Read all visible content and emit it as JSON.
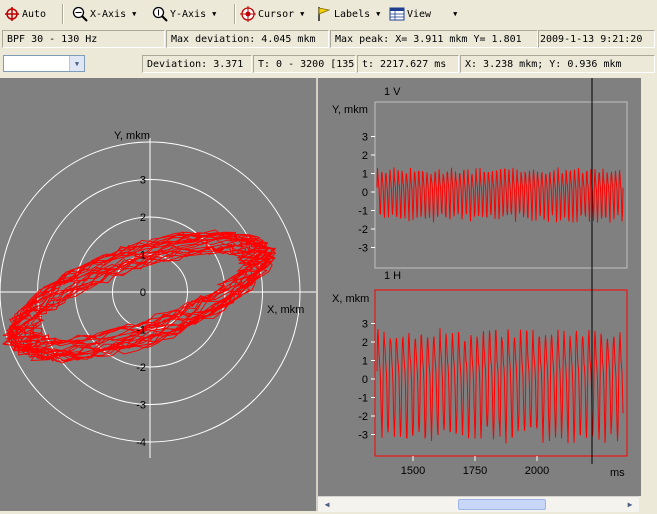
{
  "toolbar": {
    "auto": "Auto",
    "x_axis": "X-Axis",
    "y_axis": "Y-Axis",
    "cursor": "Cursor",
    "labels": "Labels",
    "view": "View"
  },
  "status1": {
    "filter": "BPF 30 - 130 Hz",
    "max_deviation": "Max deviation:  4.045 mkm",
    "max_peak": "Max peak:  X= 3.911 mkm    Y= 1.801",
    "datetime": "2009-1-13 9:21:20"
  },
  "status2": {
    "combo_value": "",
    "deviation": "Deviation:  3.371",
    "time_range": "T: 0 - 3200 [135",
    "t_value": "t: 2217.627 ms",
    "xy_value": "X: 3.238 mkm;  Y: 0.936 mkm"
  },
  "orbit": {
    "y_label": "Y, mkm",
    "x_label": "X, mkm",
    "y_ticks": [
      "3",
      "2",
      "1",
      "0",
      "-1",
      "-2",
      "-3",
      "-4"
    ]
  },
  "channel_v": {
    "title": "1 V",
    "y_label": "Y, mkm",
    "ticks": [
      "3",
      "2",
      "1",
      "0",
      "-1",
      "-2",
      "-3"
    ]
  },
  "channel_h": {
    "title": "1 H",
    "y_label": "X, mkm",
    "ticks": [
      "3",
      "2",
      "1",
      "0",
      "-1",
      "-2",
      "-3"
    ]
  },
  "time_axis": {
    "ticks": [
      "1500",
      "1750",
      "2000"
    ],
    "unit": "ms"
  },
  "colors": {
    "signal": "#ff0000",
    "grid": "#ffffff",
    "plot_bg": "#808080"
  }
}
